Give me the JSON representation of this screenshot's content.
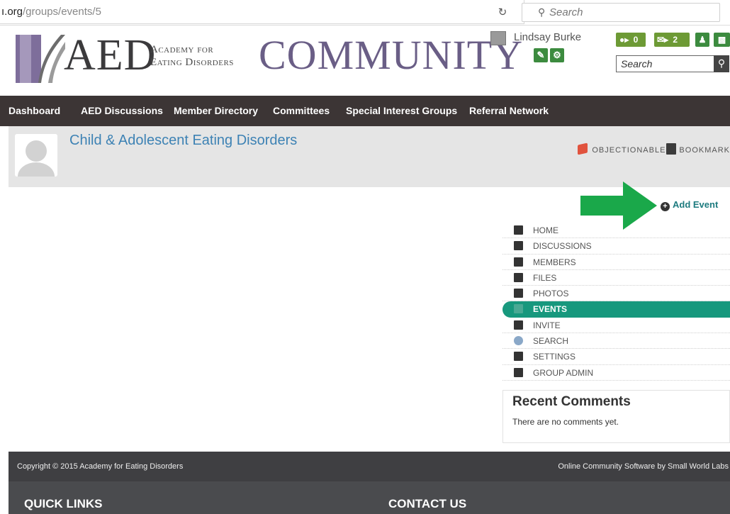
{
  "browser": {
    "url_host": "ı.org",
    "url_path": "/groups/events/5",
    "search_placeholder": "Search"
  },
  "header": {
    "logo_main": "AED",
    "logo_sub_line1": "Academy for",
    "logo_sub_line2": "Eating Disorders",
    "logo_community": "COMMUNITY",
    "user_name": "Lindsay Burke",
    "connections_count": "0",
    "messages_count": "2",
    "search_placeholder": "Search"
  },
  "nav": {
    "items": [
      "Dashboard",
      "AED Discussions",
      "Member Directory",
      "Committees",
      "Special Interest Groups",
      "Referral Network"
    ]
  },
  "group": {
    "title": "Child & Adolescent Eating Disorders",
    "objectionable_label": "OBJECTIONABLE",
    "bookmark_label": "BOOKMARK"
  },
  "actions": {
    "add_event_label": "Add Event"
  },
  "side_menu": {
    "items": [
      {
        "label": "HOME",
        "icon": "home-icon"
      },
      {
        "label": "DISCUSSIONS",
        "icon": "speech-bubble-icon"
      },
      {
        "label": "MEMBERS",
        "icon": "member-card-icon"
      },
      {
        "label": "FILES",
        "icon": "files-icon"
      },
      {
        "label": "PHOTOS",
        "icon": "camera-icon"
      },
      {
        "label": "EVENTS",
        "icon": "calendar-icon",
        "active": true
      },
      {
        "label": "INVITE",
        "icon": "invite-icon"
      },
      {
        "label": "SEARCH",
        "icon": "magnifier-icon"
      },
      {
        "label": "SETTINGS",
        "icon": "wrench-icon"
      },
      {
        "label": "GROUP ADMIN",
        "icon": "group-admin-icon"
      }
    ]
  },
  "recent_comments": {
    "title": "Recent Comments",
    "empty_text": "There are no comments yet."
  },
  "footer": {
    "copyright": "Copyright © 2015 Academy for Eating Disorders",
    "credit": "Online Community Software by Small World Labs",
    "quick_links": "QUICK LINKS",
    "contact_us": "CONTACT US"
  },
  "colors": {
    "nav_bg": "#3c3535",
    "accent_teal": "#17987d",
    "arrow_green": "#1aa84a",
    "title_blue": "#3d82b4"
  }
}
